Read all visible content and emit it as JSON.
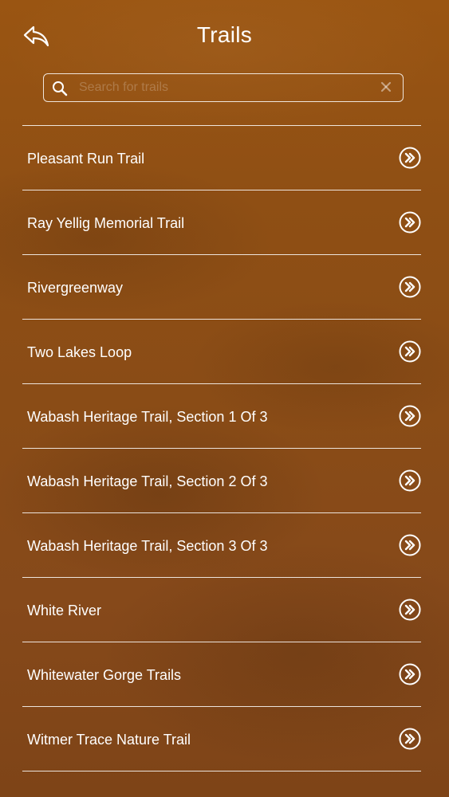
{
  "header": {
    "title": "Trails",
    "back_icon": "back-arrow-icon"
  },
  "search": {
    "placeholder": "Search for trails",
    "value": "",
    "search_icon": "search-icon",
    "clear_icon": "clear-icon"
  },
  "trails": [
    {
      "label": "Pleasant Run Trail"
    },
    {
      "label": "Ray Yellig Memorial Trail"
    },
    {
      "label": "Rivergreenway"
    },
    {
      "label": "Two Lakes Loop"
    },
    {
      "label": "Wabash Heritage Trail, Section 1 Of 3"
    },
    {
      "label": "Wabash Heritage Trail, Section 2 Of 3"
    },
    {
      "label": "Wabash Heritage Trail, Section 3 Of 3"
    },
    {
      "label": "White River"
    },
    {
      "label": "Whitewater Gorge Trails"
    },
    {
      "label": "Witmer Trace Nature Trail"
    }
  ],
  "item_icon": "double-chevron-right-icon",
  "colors": {
    "background": "#8f4f14",
    "foreground": "#ffffff"
  }
}
